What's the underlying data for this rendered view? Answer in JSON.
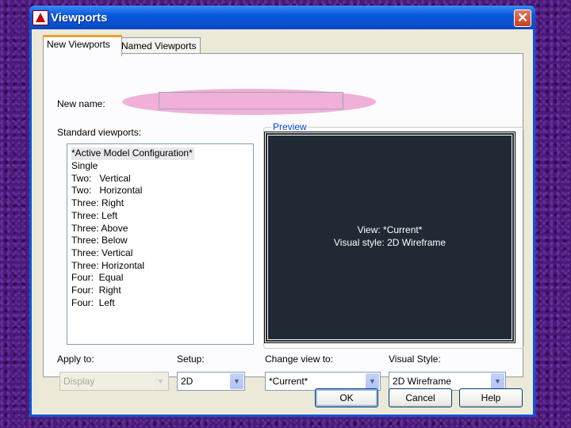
{
  "window": {
    "title": "Viewports",
    "close_glyph": "✕"
  },
  "tabs": [
    {
      "label": "New Viewports"
    },
    {
      "label": "Named Viewports"
    }
  ],
  "new_name": {
    "label": "New name:",
    "value": ""
  },
  "standard_viewports": {
    "label": "Standard viewports:",
    "items": [
      "*Active Model Configuration*",
      "Single",
      "Two:   Vertical",
      "Two:   Horizontal",
      "Three: Right",
      "Three: Left",
      "Three: Above",
      "Three: Below",
      "Three: Vertical",
      "Three: Horizontal",
      "Four:  Equal",
      "Four:  Right",
      "Four:  Left"
    ]
  },
  "preview": {
    "label": "Preview",
    "line1": "View: *Current*",
    "line2": "Visual style: 2D Wireframe"
  },
  "apply_to": {
    "label": "Apply to:",
    "value": "Display"
  },
  "setup": {
    "label": "Setup:",
    "value": "2D"
  },
  "change_view": {
    "label": "Change view to:",
    "value": "*Current*"
  },
  "visual_style": {
    "label": "Visual Style:",
    "value": "2D Wireframe"
  },
  "buttons": {
    "ok": "OK",
    "cancel": "Cancel",
    "help": "Help"
  },
  "colors": {
    "titlebar": "#0a56d8",
    "highlight": "#f0b0d8",
    "preview_bg": "#1f2a34"
  },
  "icons": {
    "app": "autocad-icon",
    "close": "close-icon",
    "dropdown": "chevron-down-icon"
  }
}
